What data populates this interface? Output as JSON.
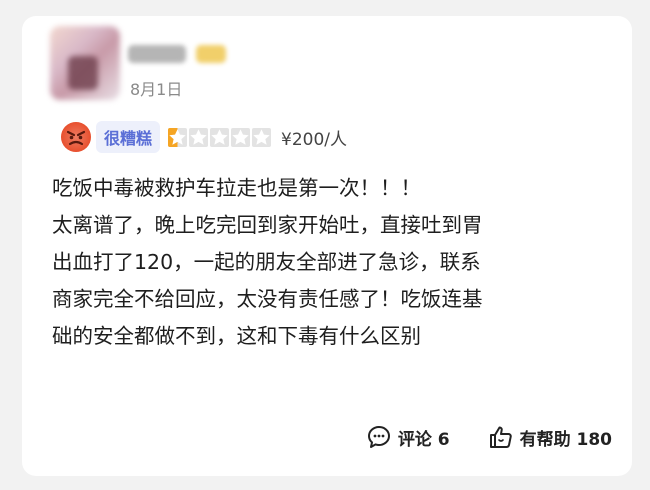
{
  "review": {
    "date": "8月1日",
    "rating_label": "很糟糕",
    "rating_stars": 0.5,
    "rating_max": 5,
    "price": "¥200/人",
    "lines": [
      "吃饭中毒被救护车拉走也是第一次！！！",
      "太离谱了，晚上吃完回到家开始吐，直接吐到胃",
      "出血打了120，一起的朋友全部进了急诊，联系",
      "商家完全不给回应，太没有责任感了！吃饭连基",
      "础的安全都做不到，这和下毒有什么区别"
    ]
  },
  "actions": {
    "comment_label": "评论 6",
    "helpful_label": "有帮助 180"
  },
  "colors": {
    "accent": "#5b6fd6",
    "star_filled": "#f5a524",
    "star_empty": "#e3e3e3",
    "mood_red": "#e8502e"
  },
  "icons": {
    "mood": "angry-face-icon",
    "comment": "comment-bubble-icon",
    "helpful": "thumbs-up-icon"
  }
}
